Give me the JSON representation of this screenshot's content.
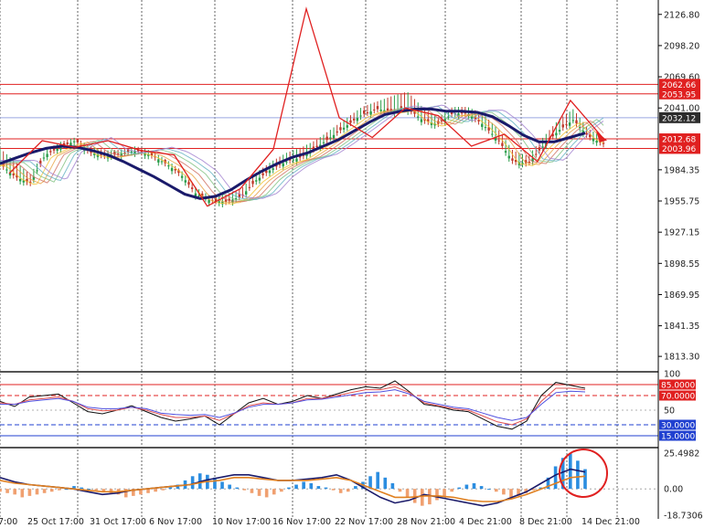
{
  "chart_data": [
    {
      "type": "line",
      "panel": "price",
      "y_axis_ticks": [
        "2126.80",
        "2098.20",
        "2069.60",
        "2041.00",
        "1984.35",
        "1955.75",
        "1927.15",
        "1898.55",
        "1869.95",
        "1841.35",
        "1813.30"
      ],
      "ylim": [
        1800,
        2140
      ],
      "series": [
        {
          "values": [
            1990,
            1978,
            1972,
            1998,
            2005,
            2011,
            2000,
            1997,
            1999,
            2002,
            1998,
            1990,
            1980,
            1962,
            1956,
            1955,
            1960,
            1975,
            1985,
            1992,
            1996,
            2005,
            2015,
            2025,
            2035,
            2040,
            2038,
            2041,
            2030,
            2026,
            2036,
            2036,
            2026,
            2012,
            1992,
            1990,
            2006,
            2020,
            2030,
            2015,
            2008
          ]
        },
        {
          "values": [
            2002,
            1990,
            1978,
            2000,
            2008,
            2012,
            2004,
            2000,
            2001,
            2004,
            2000,
            1992,
            1982,
            1966,
            1958,
            1960,
            1965,
            1980,
            1990,
            1998,
            2003,
            2010,
            2020,
            2030,
            2040,
            2045,
            2050,
            2054,
            2040,
            2030,
            2040,
            2040,
            2034,
            2020,
            2000,
            1995,
            2012,
            2028,
            2038,
            2020,
            2012
          ]
        }
      ],
      "price_tags": [
        {
          "label": "2062.66",
          "value": 2062.66,
          "color": "#e02020"
        },
        {
          "label": "2053.95",
          "value": 2053.95,
          "color": "#e02020"
        },
        {
          "label": "2032.12",
          "value": 2032.12,
          "color": "#2c2c2c"
        },
        {
          "label": "2012.68",
          "value": 2012.68,
          "color": "#e02020"
        },
        {
          "label": "2003.96",
          "value": 2003.96,
          "color": "#e02020"
        }
      ],
      "zigzag_values": [
        1981,
        2011,
        2005,
        2011,
        2002,
        1998,
        1951,
        1967,
        2003,
        2132,
        2032,
        2014,
        2041,
        2034,
        2006,
        2017,
        1992,
        2048,
        2013
      ],
      "ma_values": [
        1990,
        1995,
        2000,
        2004,
        2006,
        2005,
        2002,
        1998,
        1992,
        1985,
        1978,
        1970,
        1962,
        1958,
        1960,
        1966,
        1975,
        1983,
        1990,
        1996,
        2000,
        2006,
        2012,
        2020,
        2028,
        2035,
        2038,
        2040,
        2040,
        2038,
        2038,
        2037,
        2033,
        2025,
        2016,
        2010,
        2010,
        2014,
        2018
      ]
    },
    {
      "type": "line",
      "panel": "oscillator",
      "y_axis_ticks": [
        "100",
        "85.0000",
        "70.0000",
        "50",
        "30.0000",
        "15.0000"
      ],
      "levels": [
        {
          "label": "85.0000",
          "value": 85,
          "color": "#e02020"
        },
        {
          "label": "70.0000",
          "value": 70,
          "color": "#e02020"
        },
        {
          "label": "30.0000",
          "value": 30,
          "color": "#2040d0"
        },
        {
          "label": "15.0000",
          "value": 15,
          "color": "#2040d0"
        }
      ],
      "ylim": [
        0,
        100
      ],
      "series": [
        {
          "values": [
            62,
            55,
            68,
            70,
            72,
            60,
            48,
            45,
            50,
            56,
            48,
            40,
            35,
            38,
            42,
            30,
            45,
            60,
            66,
            58,
            62,
            70,
            66,
            72,
            78,
            82,
            80,
            90,
            75,
            58,
            55,
            50,
            48,
            38,
            28,
            24,
            35,
            70,
            88,
            84,
            80
          ]
        },
        {
          "values": [
            60,
            58,
            64,
            66,
            68,
            62,
            52,
            49,
            50,
            54,
            50,
            44,
            40,
            40,
            42,
            36,
            45,
            56,
            60,
            58,
            60,
            66,
            66,
            70,
            74,
            78,
            78,
            82,
            74,
            60,
            56,
            52,
            50,
            42,
            34,
            30,
            38,
            62,
            80,
            80,
            78
          ]
        },
        {
          "values": [
            58,
            58,
            62,
            64,
            66,
            62,
            54,
            52,
            52,
            54,
            52,
            46,
            44,
            43,
            44,
            40,
            46,
            54,
            58,
            58,
            60,
            64,
            65,
            68,
            71,
            74,
            75,
            78,
            72,
            62,
            58,
            54,
            52,
            46,
            40,
            36,
            40,
            58,
            74,
            76,
            75
          ]
        }
      ]
    },
    {
      "type": "bar",
      "panel": "macd",
      "y_axis_ticks": [
        "25.4982",
        "0.00",
        "-18.7306"
      ],
      "ylim": [
        -20,
        28
      ],
      "values": [
        -2,
        -3,
        -4,
        -6,
        -5,
        -4,
        -3,
        -2,
        -1,
        0,
        2,
        1,
        0,
        -1,
        -2,
        -3,
        -4,
        -6,
        -5,
        -4,
        -3,
        -2,
        -1,
        1,
        3,
        6,
        9,
        11,
        10,
        8,
        5,
        3,
        1,
        -1,
        -3,
        -5,
        -6,
        -4,
        -2,
        1,
        3,
        5,
        4,
        2,
        1,
        -1,
        -3,
        -2,
        2,
        5,
        9,
        12,
        8,
        4,
        -2,
        -6,
        -10,
        -12,
        -11,
        -8,
        -5,
        -2,
        1,
        3,
        4,
        2,
        0,
        -2,
        -4,
        -6,
        -5,
        -3,
        -1,
        1,
        8,
        16,
        22,
        25,
        20,
        14
      ],
      "series": [
        {
          "values": [
            8,
            5,
            3,
            2,
            1,
            0,
            -2,
            -4,
            -3,
            -1,
            0,
            1,
            2,
            3,
            6,
            8,
            10,
            10,
            8,
            6,
            6,
            7,
            8,
            10,
            6,
            0,
            -6,
            -10,
            -8,
            -4,
            -6,
            -8,
            -10,
            -12,
            -10,
            -6,
            -2,
            4,
            10,
            14,
            12
          ]
        },
        {
          "values": [
            6,
            4,
            3,
            2,
            1,
            0,
            -1,
            -2,
            -2,
            -1,
            0,
            1,
            2,
            3,
            5,
            6,
            8,
            8,
            7,
            6,
            6,
            6,
            7,
            8,
            6,
            2,
            -2,
            -6,
            -6,
            -5,
            -5,
            -6,
            -8,
            -9,
            -9,
            -7,
            -4,
            0,
            4,
            8,
            9
          ]
        }
      ]
    }
  ],
  "time_axis": [
    "7:00",
    "25 Oct 17:00",
    "31 Oct 17:00",
    "6 Nov 17:00",
    "10 Nov 17:00",
    "16 Nov 17:00",
    "22 Nov 17:00",
    "28 Nov 21:00",
    "4 Dec 21:00",
    "8 Dec 21:00",
    "14 Dec 21:00"
  ],
  "colors": {
    "zigzag": "#e02020",
    "ma_thick": "#1a1a6a",
    "bull_candle": "#2a9d4a",
    "bear_candle": "#c0392b",
    "macd_pos": "#2b8de0",
    "macd_neg": "#f0a070",
    "macd_line": "#1a1a6a",
    "signal_line": "#e08020",
    "osc_black": "#111111",
    "osc_red": "#e05050",
    "osc_blue": "#5050e0"
  }
}
